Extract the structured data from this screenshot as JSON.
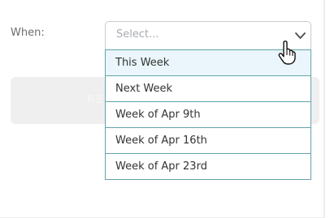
{
  "form": {
    "when_label": "When:"
  },
  "select": {
    "placeholder": "Select...",
    "options": [
      {
        "label": "This Week",
        "highlighted": true
      },
      {
        "label": "Next Week",
        "highlighted": false
      },
      {
        "label": "Week of Apr 9th",
        "highlighted": false
      },
      {
        "label": "Week of Apr 16th",
        "highlighted": false
      },
      {
        "label": "Week of Apr 23rd",
        "highlighted": false
      }
    ]
  },
  "background_button": {
    "label_fragment": "RE"
  },
  "icons": {
    "select_arrow": "chevron-down-icon",
    "cursor": "hand-pointer-icon"
  },
  "colors": {
    "dropdown_border": "#63a3aa",
    "highlight_bg": "#eaf6fb",
    "text": "#333333",
    "placeholder": "#a8abb0"
  }
}
